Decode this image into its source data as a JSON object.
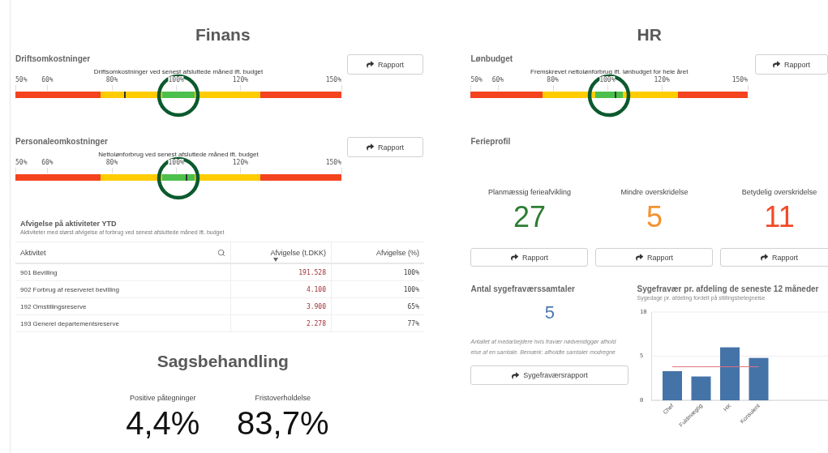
{
  "finans": {
    "title": "Finans",
    "gauges": [
      {
        "title": "Driftsomkostninger",
        "caption": "Driftsomkostninger ved senest afsluttede måned ift. budget",
        "ticks": [
          "50%",
          "60%",
          "80%",
          "100%",
          "120%",
          "150%"
        ],
        "level": 0.336,
        "circled": true,
        "button": "Rapport"
      },
      {
        "title": "Personaleomkostninger",
        "caption": "Nettolønforbrug ved senest afsluttede måned ift. budget",
        "ticks": [
          "50%",
          "60%",
          "80%",
          "100%",
          "120%",
          "150%"
        ],
        "level": 0.525,
        "circled": true,
        "button": "Rapport"
      }
    ],
    "table": {
      "title": "Afvigelse på aktiviteter YTD",
      "subtitle": "Aktiviteter med størst afvigelse af forbrug ved senest afsluttede måned ift. budget",
      "columns": [
        {
          "label": "Aktivitet",
          "kind": "search"
        },
        {
          "label": "Afvigelse (t.DKK)",
          "kind": "sorted"
        },
        {
          "label": "Afvigelse (%)",
          "kind": "plain"
        }
      ],
      "rows": [
        [
          "901 Bevilling",
          "191.528",
          "100%"
        ],
        [
          "902 Forbrug af reserveret bevilling",
          "4.100",
          "100%"
        ],
        [
          "192 Omstillingsreserve",
          "3.900",
          "65%"
        ],
        [
          "193 Generel departementsreserve",
          "2.278",
          "77%"
        ]
      ]
    }
  },
  "sagsbehandling": {
    "title": "Sagsbehandling",
    "kpis": [
      {
        "label": "Positive påtegninger",
        "value": "4,4%"
      },
      {
        "label": "Fristoverholdelse",
        "value": "83,7%"
      }
    ]
  },
  "hr": {
    "title": "HR",
    "gauge": {
      "title": "Lønbudget",
      "caption": "Fremskrevet nettolønforbrug ift. lønbudget for hele året",
      "ticks": [
        "50%",
        "60%",
        "80%",
        "100%",
        "120%",
        "150%"
      ],
      "level": 0.524,
      "circled": true,
      "button": "Rapport"
    },
    "ferieprofil": {
      "title": "Ferieprofil",
      "kpis": [
        {
          "label": "Planmæssig ferieafvikling",
          "value": "27",
          "color": "#2e7d32",
          "button": "Rapport"
        },
        {
          "label": "Mindre overskridelse",
          "value": "5",
          "color": "#f5922e",
          "button": "Rapport"
        },
        {
          "label": "Betydelig overskridelse",
          "value": "11",
          "color": "#f44a28",
          "button": "Rapport"
        }
      ]
    },
    "samtaler": {
      "title": "Antal sygefraværssamtaler",
      "value": "5",
      "note": [
        "Antallet af medarbejdere hvis fravær nødvendiggør afhold",
        "else af en samtale. Bemærk: afholdte samtaler modregne"
      ],
      "button": "Sygefraværsrapport"
    },
    "sygefravaer": {
      "title": "Sygefravær pr. afdeling de seneste 12 måneder",
      "subtitle": "Sygedage pr. afdeling fordelt på stillingsbetegnelse",
      "chart_data": {
        "type": "bar",
        "categories": [
          "Chef",
          "Fuldmægtig",
          "HK",
          "Konsulent"
        ],
        "series": [
          {
            "color": "#4473a8",
            "values": [
              3.3,
              2.7,
              6.0,
              4.8
            ]
          },
          {
            "type": "line",
            "color": "#e07080",
            "values": [
              3.8,
              3.8,
              3.8,
              3.8
            ]
          }
        ],
        "ylim": [
          0,
          10
        ],
        "yticks": [
          0,
          5,
          10
        ]
      }
    }
  }
}
